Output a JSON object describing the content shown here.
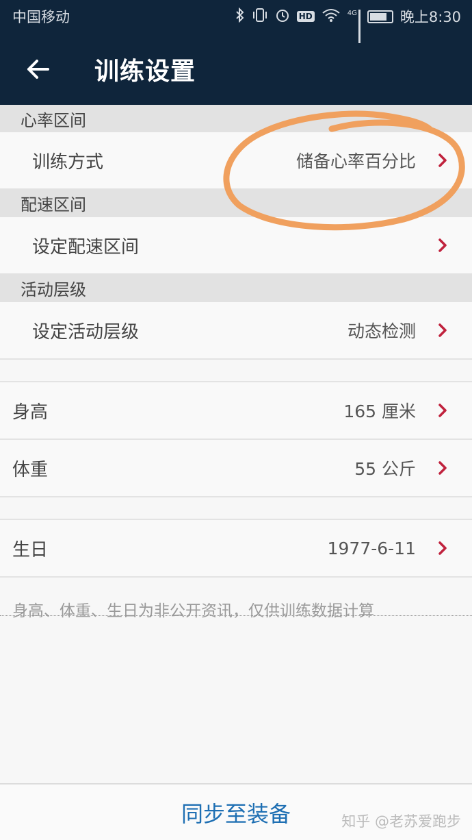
{
  "status_bar": {
    "carrier": "中国移动",
    "network": "4G",
    "hd": "HD",
    "time": "晚上8:30"
  },
  "header": {
    "title": "训练设置"
  },
  "sections": {
    "heart_rate": {
      "header": "心率区间",
      "row_label": "训练方式",
      "row_value": "储备心率百分比"
    },
    "pace": {
      "header": "配速区间",
      "row_label": "设定配速区间"
    },
    "activity": {
      "header": "活动层级",
      "row_label": "设定活动层级",
      "row_value": "动态检测"
    }
  },
  "profile": {
    "height_label": "身高",
    "height_value": "165 厘米",
    "weight_label": "体重",
    "weight_value": "55 公斤",
    "birthday_label": "生日",
    "birthday_value": "1977-6-11"
  },
  "note": "身高、体重、生日为非公开资讯，仅供训练数据计算",
  "footer": {
    "sync_label": "同步至装备"
  },
  "watermark": "知乎 @老苏爱跑步",
  "colors": {
    "header_bg": "#0f253b",
    "chevron": "#c0223d",
    "sync_text": "#1e6fb3",
    "annotation": "#f0a05e"
  }
}
